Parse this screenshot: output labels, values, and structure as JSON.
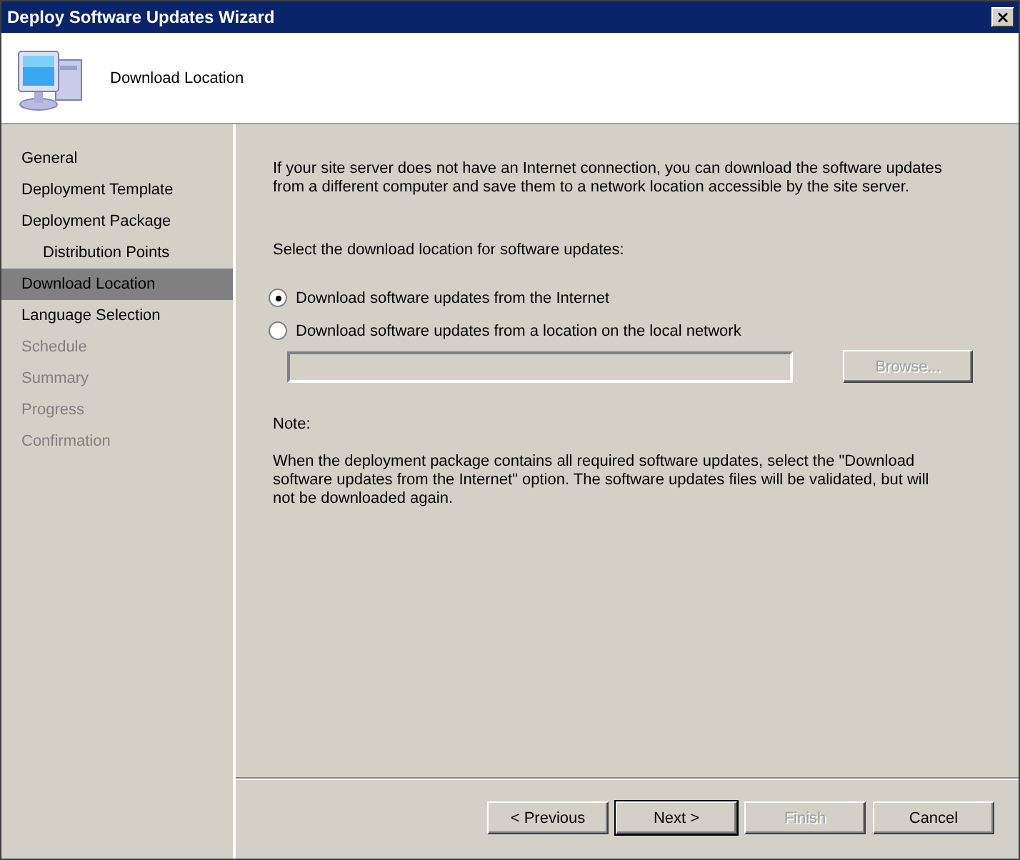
{
  "window": {
    "title": "Deploy Software Updates Wizard",
    "close": "×"
  },
  "header": {
    "title": "Download Location"
  },
  "sidebar": {
    "items": [
      {
        "label": "General",
        "selected": false,
        "disabled": false
      },
      {
        "label": "Deployment Template",
        "selected": false,
        "disabled": false
      },
      {
        "label": "Deployment Package",
        "selected": false,
        "disabled": false,
        "children": [
          {
            "label": "Distribution Points",
            "selected": false,
            "disabled": false
          }
        ]
      },
      {
        "label": "Download Location",
        "selected": true,
        "disabled": false
      },
      {
        "label": "Language Selection",
        "selected": false,
        "disabled": false
      },
      {
        "label": "Schedule",
        "selected": false,
        "disabled": true
      },
      {
        "label": "Summary",
        "selected": false,
        "disabled": true
      },
      {
        "label": "Progress",
        "selected": false,
        "disabled": true
      },
      {
        "label": "Confirmation",
        "selected": false,
        "disabled": true
      }
    ]
  },
  "content": {
    "intro": "If your site server does not have an Internet connection, you can download the software updates from a different computer and save them to a network location accessible by the site server.",
    "prompt": "Select the download location for software updates:",
    "options": [
      {
        "label": "Download software updates from the Internet",
        "selected": true
      },
      {
        "label": "Download software updates from a location on the local network",
        "selected": false
      }
    ],
    "path_field": {
      "disabled": true
    },
    "browse_button": {
      "label": "Browse...",
      "disabled": true
    },
    "note_label": "Note:",
    "note": "When the deployment package contains all required software updates, select the \"Download software updates from the Internet\" option. The software updates files will be validated, but will not be downloaded again."
  },
  "buttons": [
    {
      "label": "< Previous",
      "disabled": false,
      "default": false
    },
    {
      "label": "Next >",
      "disabled": false,
      "default": true
    },
    {
      "label": "Finish",
      "disabled": true,
      "default": false
    },
    {
      "label": "Cancel",
      "disabled": false,
      "default": false
    }
  ]
}
